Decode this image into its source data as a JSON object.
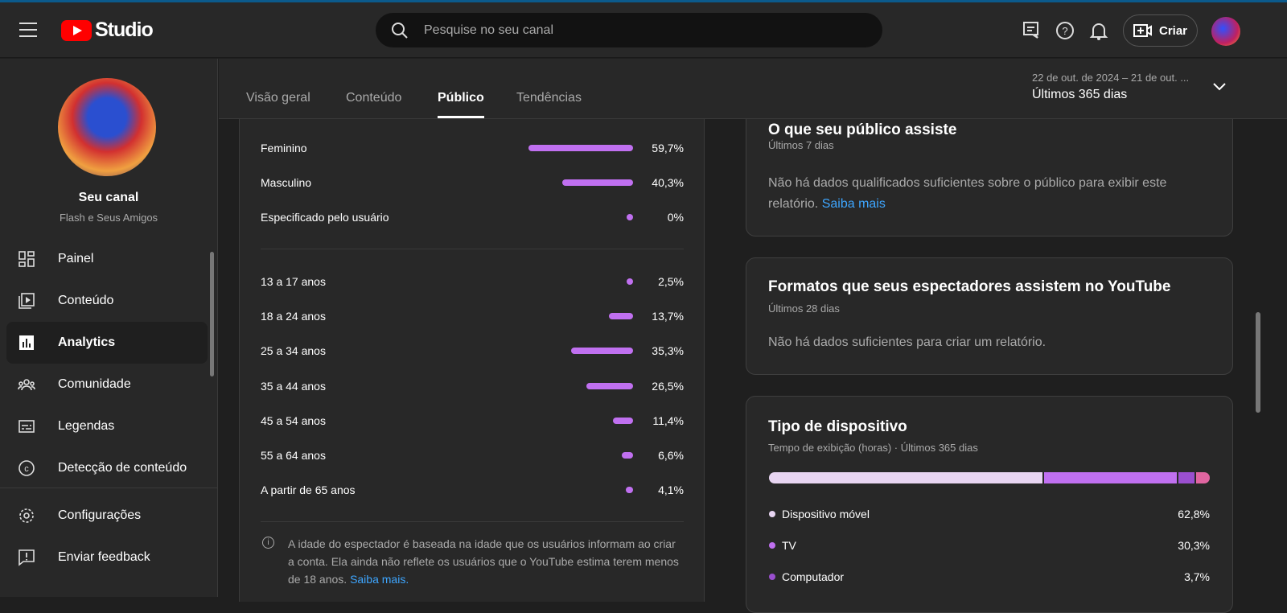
{
  "header": {
    "app": "Studio",
    "search_placeholder": "Pesquise no seu canal",
    "create_label": "Criar"
  },
  "sidebar": {
    "channel_title": "Seu canal",
    "channel_name": "Flash e Seus Amigos",
    "items": [
      {
        "label": "Painel",
        "icon": "dashboard-icon"
      },
      {
        "label": "Conteúdo",
        "icon": "content-icon"
      },
      {
        "label": "Analytics",
        "icon": "analytics-icon",
        "active": true
      },
      {
        "label": "Comunidade",
        "icon": "community-icon"
      },
      {
        "label": "Legendas",
        "icon": "subtitles-icon"
      },
      {
        "label": "Detecção de conteúdo",
        "icon": "copyright-icon"
      }
    ],
    "bottom": [
      {
        "label": "Configurações",
        "icon": "gear-icon"
      },
      {
        "label": "Enviar feedback",
        "icon": "feedback-icon"
      }
    ]
  },
  "tabs": [
    {
      "label": "Visão geral"
    },
    {
      "label": "Conteúdo"
    },
    {
      "label": "Público",
      "active": true
    },
    {
      "label": "Tendências"
    }
  ],
  "date_range": {
    "range": "22 de out. de 2024 – 21 de out. ...",
    "label": "Últimos 365 dias"
  },
  "gender": [
    {
      "label": "Feminino",
      "value": 59.7,
      "text": "59,7%"
    },
    {
      "label": "Masculino",
      "value": 40.3,
      "text": "40,3%"
    },
    {
      "label": "Especificado pelo usuário",
      "value": 0,
      "text": "0%"
    }
  ],
  "age": [
    {
      "label": "13 a 17 anos",
      "value": 2.5,
      "text": "2,5%"
    },
    {
      "label": "18 a 24 anos",
      "value": 13.7,
      "text": "13,7%"
    },
    {
      "label": "25 a 34 anos",
      "value": 35.3,
      "text": "35,3%"
    },
    {
      "label": "35 a 44 anos",
      "value": 26.5,
      "text": "26,5%"
    },
    {
      "label": "45 a 54 anos",
      "value": 11.4,
      "text": "11,4%"
    },
    {
      "label": "55 a 64 anos",
      "value": 6.6,
      "text": "6,6%"
    },
    {
      "label": "A partir de 65 anos",
      "value": 4.1,
      "text": "4,1%"
    }
  ],
  "age_note": {
    "text": "A idade do espectador é baseada na idade que os usuários informam ao criar a conta. Ela ainda não reflete os usuários que o YouTube estima terem menos de 18 anos.",
    "link": "Saiba mais."
  },
  "watch_card": {
    "title": "O que seu público assiste",
    "sub": "Últimos 7 dias",
    "msg": "Não há dados qualificados suficientes sobre o público para exibir este relatório.",
    "link": "Saiba mais"
  },
  "formats_card": {
    "title": "Formatos que seus espectadores assistem no YouTube",
    "sub": "Últimos 28 dias",
    "msg": "Não há dados suficientes para criar um relatório."
  },
  "device_card": {
    "title": "Tipo de dispositivo",
    "sub": "Tempo de exibição (horas) · Últimos 365 dias",
    "items": [
      {
        "label": "Dispositivo móvel",
        "value": 62.8,
        "text": "62,8%",
        "color": "#e8d5f2"
      },
      {
        "label": "TV",
        "value": 30.3,
        "text": "30,3%",
        "color": "#c070f0"
      },
      {
        "label": "Computador",
        "value": 3.7,
        "text": "3,7%",
        "color": "#9a4fcf"
      },
      {
        "value": 3.2,
        "color": "#e065a0"
      }
    ]
  }
}
